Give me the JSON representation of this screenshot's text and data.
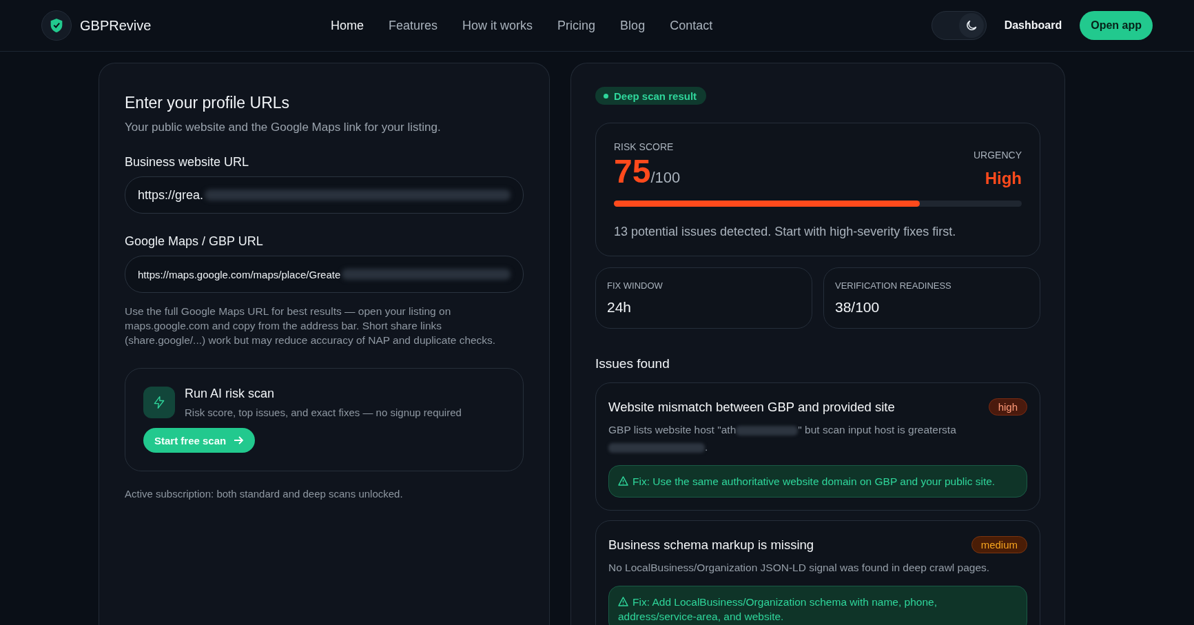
{
  "header": {
    "brand": "GBPRevive",
    "nav": [
      {
        "label": "Home",
        "selected": true
      },
      {
        "label": "Features",
        "selected": false
      },
      {
        "label": "How it works",
        "selected": false
      },
      {
        "label": "Pricing",
        "selected": false
      },
      {
        "label": "Blog",
        "selected": false
      },
      {
        "label": "Contact",
        "selected": false
      }
    ],
    "theme_toggle": {
      "on": true
    },
    "dashboard": "Dashboard",
    "cta": "Open app"
  },
  "form": {
    "title": "Enter your profile URLs",
    "subtitle": "Your public website and the Google Maps link for your listing.",
    "fields": [
      {
        "label": "Business website URL",
        "value": "https://grea.",
        "redacted": true,
        "kind": "standard"
      },
      {
        "label": "Google Maps / GBP URL",
        "value": "https://maps.google.com/maps/place/Greate",
        "redacted": true,
        "kind": "compact"
      }
    ],
    "hint": "Use the full Google Maps URL for best results — open your listing on maps.google.com and copy from the address bar. Short share links (share.google/...) work but may reduce accuracy of NAP and duplicate checks.",
    "scan_card": {
      "title": "Run AI risk scan",
      "subtitle": "Risk score, top issues, and exact fixes — no signup required",
      "button": "Start free scan"
    },
    "footnote": "Active subscription: both standard and deep scans unlocked."
  },
  "result": {
    "badge": "Deep scan result",
    "risk": {
      "label": "RISK SCORE",
      "score": "75",
      "max": "/100",
      "level": 0.75,
      "urgency_label": "URGENCY",
      "urgency": "High",
      "summary": "13 potential issues detected. Start with high-severity fixes first."
    },
    "stats": [
      {
        "label": "FIX WINDOW",
        "value": "24h"
      },
      {
        "label": "VERIFICATION READINESS",
        "value": "38/100"
      }
    ],
    "issues_title": "Issues found",
    "issues": [
      {
        "title": "Website mismatch between GBP and provided site",
        "severity": "high",
        "description": [
          {
            "kind": "text",
            "text": "GBP lists website host \"ath"
          },
          {
            "kind": "redacted"
          },
          {
            "kind": "text",
            "text": "\" but scan input host is greatersta"
          },
          {
            "kind": "redacted"
          },
          {
            "kind": "text",
            "text": "."
          }
        ],
        "fix": "Fix: Use the same authoritative website domain on GBP and your public site."
      },
      {
        "title": "Business schema markup is missing",
        "severity": "medium",
        "description": [
          {
            "kind": "text",
            "text": "No LocalBusiness/Organization JSON-LD signal was found in deep crawl pages."
          }
        ],
        "fix": "Fix: Add LocalBusiness/Organization schema with name, phone, address/service-area, and website."
      }
    ]
  }
}
